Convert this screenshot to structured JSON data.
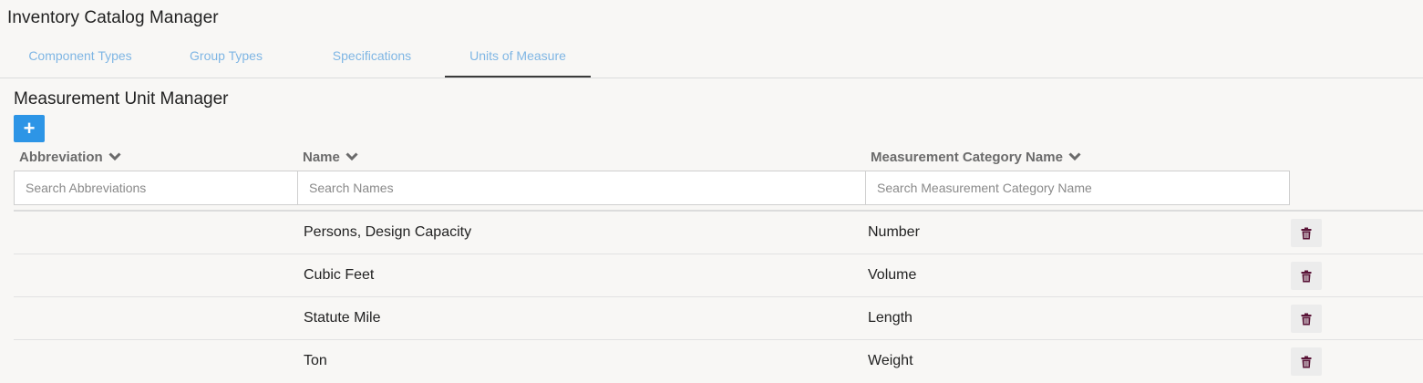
{
  "app": {
    "title": "Inventory Catalog Manager"
  },
  "tabs": [
    {
      "label": "Component Types",
      "active": false
    },
    {
      "label": "Group Types",
      "active": false
    },
    {
      "label": "Specifications",
      "active": false
    },
    {
      "label": "Units of Measure",
      "active": true
    }
  ],
  "section": {
    "title": "Measurement Unit Manager",
    "add_label": "+"
  },
  "columns": [
    {
      "label": "Abbreviation",
      "icon": "chevron-down-icon"
    },
    {
      "label": "Name",
      "icon": "chevron-down-icon"
    },
    {
      "label": "Measurement Category Name",
      "icon": "chevron-down-icon"
    }
  ],
  "search": {
    "abbreviation_placeholder": "Search Abbreviations",
    "name_placeholder": "Search Names",
    "category_placeholder": "Search Measurement Category Name"
  },
  "rows": [
    {
      "abbreviation": "",
      "name": "Persons, Design Capacity",
      "category": "Number"
    },
    {
      "abbreviation": "",
      "name": "Cubic Feet",
      "category": "Volume"
    },
    {
      "abbreviation": "",
      "name": "Statute Mile",
      "category": "Length"
    },
    {
      "abbreviation": "",
      "name": "Ton",
      "category": "Weight"
    }
  ],
  "colors": {
    "accent": "#2d95e6",
    "tab_text": "#7fb6e4",
    "trash_icon": "#5a1538"
  }
}
